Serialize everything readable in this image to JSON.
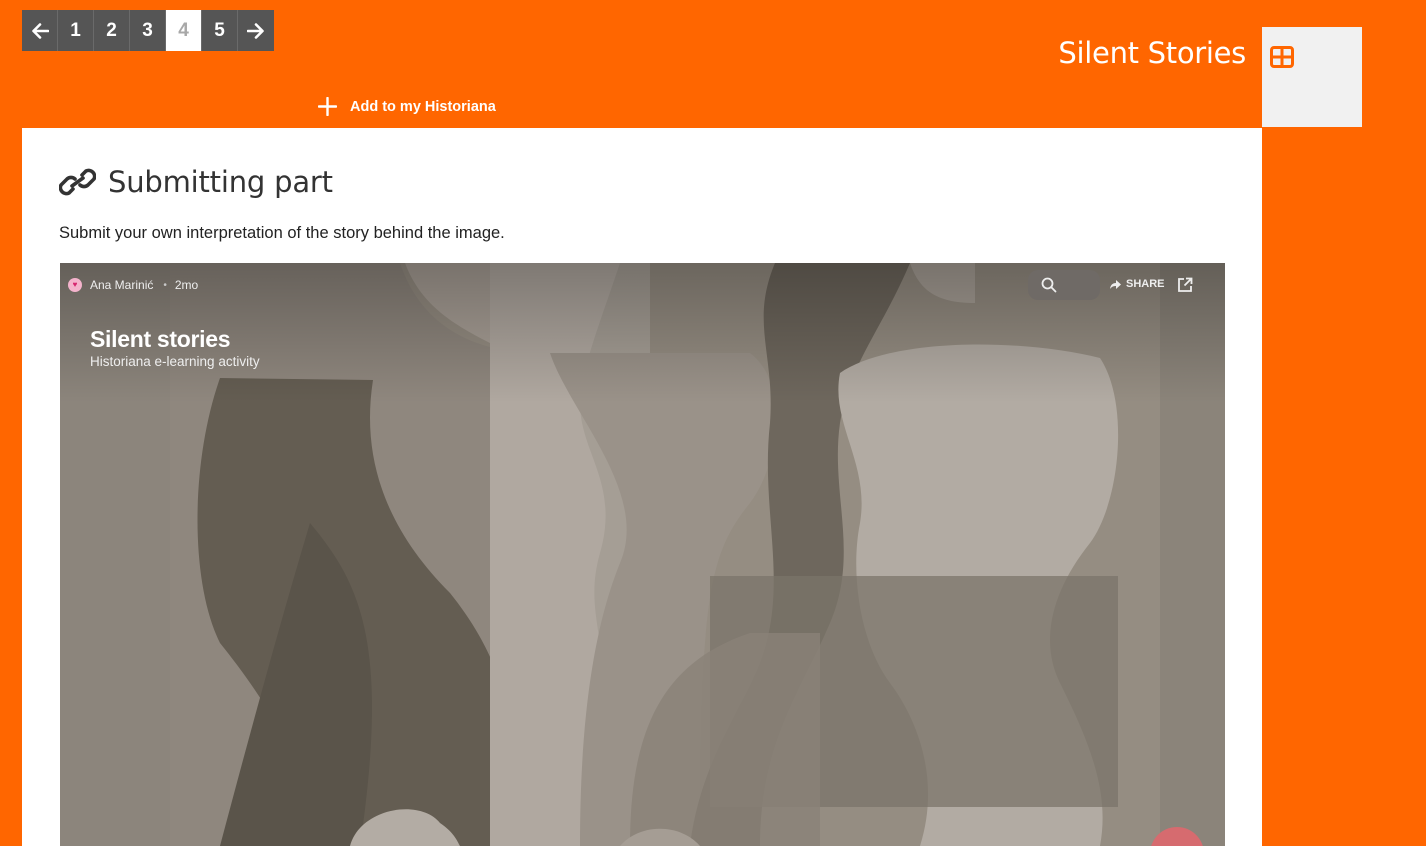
{
  "pagination": {
    "prev_icon": "arrow-left-icon",
    "pages": [
      "1",
      "2",
      "3",
      "4",
      "5"
    ],
    "active_page": "4",
    "next_icon": "arrow-right-icon"
  },
  "header": {
    "site_title": "Silent Stories",
    "grid_icon": "grid-icon",
    "add_label": "Add to my Historiana",
    "colors": {
      "brand": "#ff6600",
      "pager": "#555555"
    }
  },
  "content": {
    "heading": "Submitting part",
    "heading_icon": "link-icon",
    "intro": "Submit your own interpretation of the story behind the image."
  },
  "embed": {
    "author": "Ana Marinić",
    "age": "2mo",
    "title": "Silent stories",
    "subtitle": "Historiana e-learning activity",
    "share_label": "SHARE",
    "search_icon": "search-icon",
    "open_icon": "external-link-icon"
  }
}
